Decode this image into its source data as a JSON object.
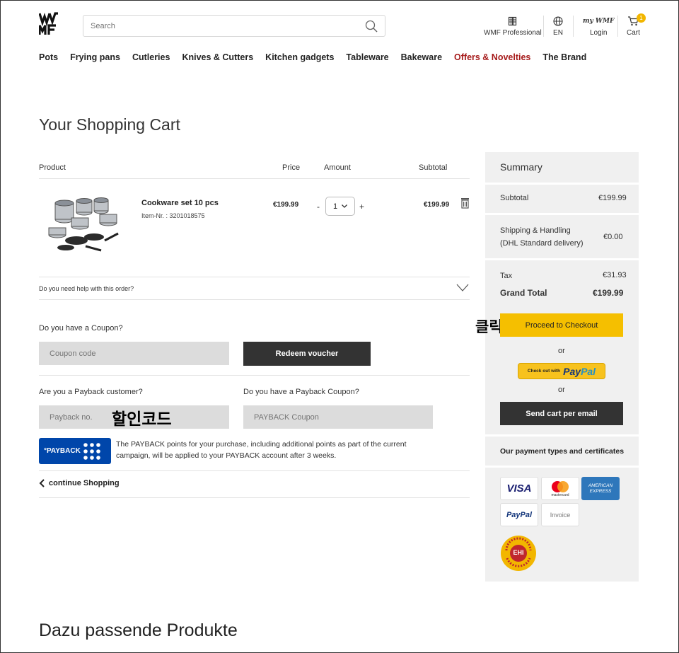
{
  "header": {
    "search_placeholder": "Search",
    "professional_label": "WMF Professional",
    "lang_label": "EN",
    "mywmf_label": "my WMF",
    "login_label": "Login",
    "cart_label": "Cart",
    "cart_count": "1"
  },
  "nav": {
    "items": [
      "Pots",
      "Frying pans",
      "Cutleries",
      "Knives & Cutters",
      "Kitchen gadgets",
      "Tableware",
      "Bakeware",
      "Offers & Novelties",
      "The Brand"
    ]
  },
  "page_title": "Your Shopping Cart",
  "cart": {
    "col_product": "Product",
    "col_price": "Price",
    "col_amount": "Amount",
    "col_subtotal": "Subtotal",
    "item": {
      "name": "Cookware set 10 pcs",
      "number": "Item-Nr. : 3201018575",
      "price": "€199.99",
      "qty_minus": "-",
      "qty": "1",
      "qty_plus": "+",
      "subtotal": "€199.99"
    },
    "help": "Do you need help with this order?"
  },
  "coupon": {
    "question": "Do you have a Coupon?",
    "placeholder": "Coupon code",
    "redeem_label": "Redeem voucher"
  },
  "payback": {
    "customer_question": "Are you a Payback customer?",
    "customer_placeholder": "Payback no.",
    "coupon_question": "Do you have a Payback Coupon?",
    "coupon_placeholder": "PAYBACK Coupon",
    "logo_text": "°PAYBACK",
    "info": "The PAYBACK points for your purchase, including additional points as part of the current campaign, will be applied to your PAYBACK account after 3 weeks."
  },
  "continue_label": "continue Shopping",
  "annotations": {
    "discount_code": "할인코드",
    "click": "클릭"
  },
  "summary": {
    "title": "Summary",
    "subtotal_label": "Subtotal",
    "subtotal_value": "€199.99",
    "shipping_label_1": "Shipping & Handling",
    "shipping_label_2": "(DHL Standard delivery)",
    "shipping_value": "€0.00",
    "tax_label": "Tax",
    "tax_value": "€31.93",
    "grand_total_label": "Grand Total",
    "grand_total_value": "€199.99",
    "checkout_label": "Proceed to Checkout",
    "or_label": "or",
    "paypal_prefix": "Check out with",
    "paypal_pay": "Pay",
    "paypal_pal": "Pal",
    "email_label": "Send cart per email",
    "payment_title": "Our payment types and certificates",
    "visa": "VISA",
    "mastercard": "mastercard",
    "amex_1": "AMERICAN",
    "amex_2": "EXPRESS",
    "paypal_card": "PayPal",
    "invoice": "Invoice",
    "ehi_text": "EHI",
    "ehi_ring": "GEPRÜFTER ONLINE-SHOP"
  },
  "bottom_title": "Dazu passende Produkte",
  "colors": {
    "accent_red": "#a61a1a",
    "checkout_yellow": "#f5bf00",
    "payback_blue": "#0046aa",
    "dark_button": "#333333"
  }
}
